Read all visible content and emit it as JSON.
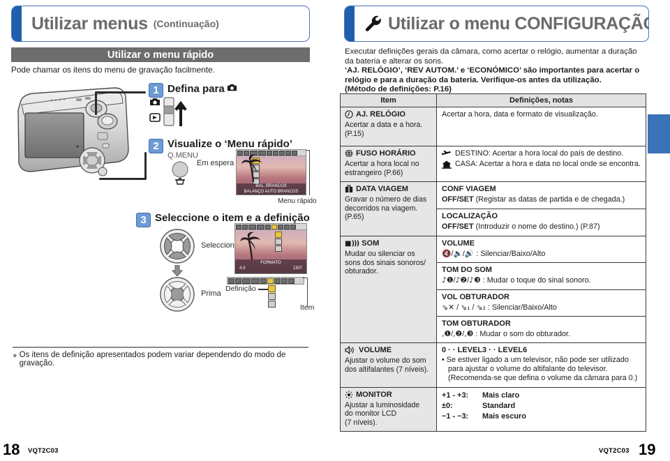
{
  "left_page": {
    "banner": {
      "title": "Utilizar menus",
      "subtitle": "(Continuação)"
    },
    "section_band": "Utilizar o menu rápido",
    "lead": "Pode chamar os itens do menu de gravação facilmente.",
    "steps": [
      {
        "num": "1",
        "title": "Defina para",
        "title_icon": "camera-rec-icon"
      },
      {
        "num": "2",
        "title": "Visualize o ‘Menu rápido’",
        "button_label": "Q.MENU",
        "note": "Em espera"
      },
      {
        "num": "3",
        "title": "Seleccione o item e a definição",
        "dpad_label": "Seleccione",
        "press_label": "Prima"
      }
    ],
    "callouts": {
      "quick_menu": "Menu rápido",
      "definition": "Definição",
      "item": "Item"
    },
    "lcd_step2": {
      "top_text": "BAL. BRANCOS",
      "bottom_text": "BALANÇO AUTO BRANCOS"
    },
    "lcd_step3": {
      "label": "FORMATO",
      "value_left": "4:3",
      "value_right": "1307"
    },
    "footnote": "Os itens de definição apresentados podem variar dependendo do modo de gravação.",
    "page_number": "18",
    "page_code": "VQT2C03"
  },
  "right_page": {
    "banner": {
      "icon": "wrench-icon",
      "title": "Utilizar o menu CONFIGURAÇÃO"
    },
    "intro": [
      {
        "text": "Executar definições gerais da câmara, como acertar o relógio, aumentar a duração da bateria e alterar os sons.",
        "bold": false
      },
      {
        "text": "‘AJ. RELÓGIO’, ‘REV AUTOM.’ e ‘ECONÓMICO’ são importantes para acertar o relógio e para a duração da bateria. Verifique-os antes da utilização.",
        "bold": true
      },
      {
        "text": "(Método de definições: P.16)",
        "bold": true
      }
    ],
    "table": {
      "headers": [
        "Item",
        "Definições, notas"
      ],
      "rows": [
        {
          "icon": "clock-icon",
          "item": "AJ. RELÓGIO",
          "desc": "Acertar a data e a hora.\n(P.15)",
          "cells": [
            {
              "lines": [
                {
                  "text": "Acertar a hora, data e formato de visualização.",
                  "style": "plain"
                }
              ]
            }
          ]
        },
        {
          "icon": "globe-icon",
          "item": "FUSO HORÁRIO",
          "desc": "Acertar a hora local no\nestrangeiro (P.66)",
          "cells": [
            {
              "lines": [
                {
                  "text": "DESTINO: Acertar a hora local do país de destino.",
                  "style": "icon-plane-bold-label"
                },
                {
                  "text": "CASA: Acertar a hora e data no local onde se encontra.",
                  "style": "icon-house-bold-label"
                }
              ]
            }
          ]
        },
        {
          "icon": "suitcase-icon",
          "item": "DATA VIAGEM",
          "desc": "Gravar o número de dias\ndecorridos na viagem.\n(P.65)",
          "cells": [
            {
              "lines": [
                {
                  "text": "CONF VIAGEM",
                  "style": "head"
                },
                {
                  "text": "OFF/SET (Registar as datas de partida e de chegada.)",
                  "style": "bold-prefix",
                  "prefix": "OFF/SET"
                }
              ]
            },
            {
              "lines": [
                {
                  "text": "LOCALIZAÇÃO",
                  "style": "head"
                },
                {
                  "text": "OFF/SET (Introduzir o nome do destino.) (P.87)",
                  "style": "bold-prefix",
                  "prefix": "OFF/SET"
                }
              ]
            }
          ]
        },
        {
          "icon": "beep-icon",
          "item": "SOM",
          "item_prefix": "■))) ",
          "desc": "Mudar ou silenciar os\nsons dos sinais sonoros/\nobturador.",
          "cells": [
            {
              "lines": [
                {
                  "text": "VOLUME",
                  "style": "head"
                },
                {
                  "text": ": Silenciar/Baixo/Alto",
                  "style": "glyph-row",
                  "glyphs": "mute/low/high-speaker"
                }
              ]
            },
            {
              "lines": [
                {
                  "text": "TOM DO SOM",
                  "style": "head"
                },
                {
                  "text": ": Mudar o toque do sinal sonoro.",
                  "style": "glyph-row",
                  "glyphs": "tone-1/2/3"
                }
              ]
            },
            {
              "lines": [
                {
                  "text": "VOL OBTURADOR",
                  "style": "head"
                },
                {
                  "text": ": Silenciar/Baixo/Alto",
                  "style": "glyph-row",
                  "glyphs": "shutter-mute/low/high"
                }
              ]
            },
            {
              "lines": [
                {
                  "text": "TOM OBTURADOR",
                  "style": "head"
                },
                {
                  "text": ": Mudar o som do obturador.",
                  "style": "glyph-row",
                  "glyphs": "shutter-tone-1/2/3"
                }
              ]
            }
          ]
        },
        {
          "icon": "speaker-icon",
          "item": "VOLUME",
          "desc": "Ajustar o volume do som\ndos altifalantes (7 níveis).",
          "cells": [
            {
              "lines": [
                {
                  "text": "0 · · LEVEL3 · · LEVEL6",
                  "style": "head"
                },
                {
                  "text": "• Se estiver ligado a um televisor, não pode ser utilizado para ajustar o volume do altifalante do televisor. (Recomenda-se que defina o volume da câmara para 0.)",
                  "style": "plain"
                }
              ]
            }
          ]
        },
        {
          "icon": "brightness-icon",
          "item": "MONITOR",
          "desc": "Ajustar a luminosidade\ndo monitor LCD\n(7 níveis).",
          "cells": [
            {
              "lines": [
                {
                  "text": "+1 - +3:",
                  "style": "kv",
                  "value": "Mais claro"
                },
                {
                  "text": "±0:",
                  "style": "kv",
                  "value": "Standard"
                },
                {
                  "text": "−1 - −3:",
                  "style": "kv",
                  "value": "Mais escuro"
                }
              ]
            }
          ]
        }
      ]
    },
    "page_number": "19",
    "page_code": "VQT2C03"
  },
  "colors": {
    "banner_border": "#4a73b5",
    "banner_tab": "#1f5fae",
    "band_gray": "#6d6d6d",
    "index_tab_blue": "#3a73b8",
    "step_badge": "#6d9bd4",
    "item_cell": "#e6e6e6"
  }
}
